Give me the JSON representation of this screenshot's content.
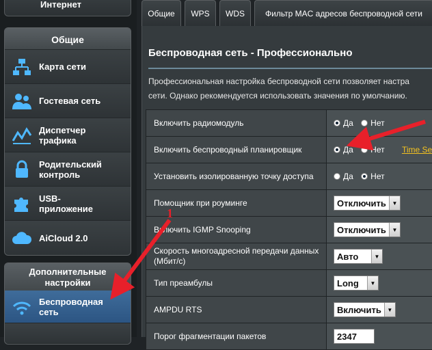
{
  "sidebar": {
    "top_item": "Интернет",
    "general_header": "Общие",
    "general_items": [
      {
        "label1": "Карта сети",
        "label2": "",
        "icon": "network-map-icon"
      },
      {
        "label1": "Гостевая сеть",
        "label2": "",
        "icon": "guest-network-icon"
      },
      {
        "label1": "Диспетчер",
        "label2": "трафика",
        "icon": "traffic-manager-icon"
      },
      {
        "label1": "Родительский",
        "label2": "контроль",
        "icon": "lock-icon"
      },
      {
        "label1": "USB-",
        "label2": "приложение",
        "icon": "puzzle-icon"
      },
      {
        "label1": "AiCloud 2.0",
        "label2": "",
        "icon": "cloud-icon"
      }
    ],
    "advanced_header_line1": "Дополнительные",
    "advanced_header_line2": "настройки",
    "advanced_items": [
      {
        "label1": "Беспроводная",
        "label2": "сеть",
        "icon": "wifi-icon"
      }
    ]
  },
  "tabs": [
    "Общие",
    "WPS",
    "WDS",
    "Фильтр MAC адресов беспроводной сети"
  ],
  "main": {
    "title": "Беспроводная сеть - Профессионально",
    "desc_line1": "Профессиональная настройка беспроводной сети позволяет настра",
    "desc_line2": "сети. Однако рекомендуется использовать значения по умолчанию."
  },
  "settings": [
    {
      "label": "Включить радиомодуль",
      "type": "radio",
      "yes": "Да",
      "no": "Нет",
      "selected": "yes"
    },
    {
      "label": "Включить беспроводный планировщик",
      "type": "radio",
      "yes": "Да",
      "no": "Нет",
      "selected": "yes",
      "link": "Time Se"
    },
    {
      "label": "Установить изолированную точку доступа",
      "type": "radio",
      "yes": "Да",
      "no": "Нет",
      "selected": "no"
    },
    {
      "label": "Помощник при роуминге",
      "type": "select",
      "value": "Отключить"
    },
    {
      "label": "Включить IGMP Snooping",
      "type": "select",
      "value": "Отключить"
    },
    {
      "label": "Скорость многоадресной передачи данных (Мбит/с)",
      "type": "select",
      "value": "Авто"
    },
    {
      "label": "Тип преамбулы",
      "type": "select",
      "value": "Long"
    },
    {
      "label": "AMPDU RTS",
      "type": "select",
      "value": "Включить"
    },
    {
      "label": "Порог фрагментации пакетов",
      "type": "input",
      "value": "2347"
    }
  ],
  "annotation": {
    "number": "1",
    "color": "#e8202a"
  }
}
